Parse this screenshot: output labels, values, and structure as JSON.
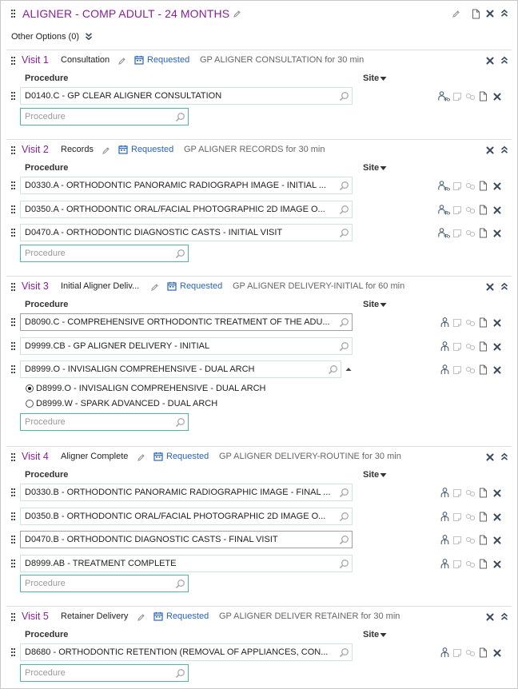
{
  "plan": {
    "title": "ALIGNER - COMP ADULT - 24 MONTHS",
    "other_options": "Other Options (0)"
  },
  "labels": {
    "procedure": "Procedure",
    "site": "Site",
    "procedure_placeholder": "Procedure"
  },
  "visits": [
    {
      "number": "Visit 1",
      "name": "Consultation",
      "status": "Requested",
      "description": "GP ALIGNER CONSULTATION for 30 min",
      "procedures": [
        "D0140.C - GP CLEAR ALIGNER CONSULTATION"
      ]
    },
    {
      "number": "Visit 2",
      "name": "Records",
      "status": "Requested",
      "description": "GP ALIGNER RECORDS for 30 min",
      "procedures": [
        "D0330.A - ORTHODONTIC PANORAMIC RADIOGRAPH IMAGE - INITIAL ...",
        "D0350.A - ORTHODONTIC ORAL/FACIAL PHOTOGRAPHIC 2D IMAGE O...",
        "D0470.A - ORTHODONTIC DIAGNOSTIC CASTS - INITIAL VISIT"
      ]
    },
    {
      "number": "Visit 3",
      "name": "Initial Aligner Deliv...",
      "status": "Requested",
      "description": "GP ALIGNER DELIVERY-INITIAL for 60 min",
      "procedures": [
        "D8090.C - COMPREHENSIVE ORTHODONTIC TREATMENT OF THE ADU...",
        "D9999.CB - GP ALIGNER DELIVERY - INITIAL",
        "D8999.O - INVISALIGN COMPREHENSIVE - DUAL ARCH"
      ],
      "options": [
        {
          "label": "D8999.O - INVISALIGN COMPREHENSIVE - DUAL ARCH",
          "selected": true
        },
        {
          "label": "D8999.W - SPARK ADVANCED - DUAL ARCH",
          "selected": false
        }
      ]
    },
    {
      "number": "Visit 4",
      "name": "Aligner Complete",
      "status": "Requested",
      "description": "GP ALIGNER DELIVERY-ROUTINE for 30 min",
      "procedures": [
        "D0330.B - ORTHODONTIC PANORAMIC RADIOGRAPHIC IMAGE - FINAL ...",
        "D0350.B - ORTHODONTIC ORAL/FACIAL PHOTOGRAPHIC 2D IMAGE O...",
        "D0470.B - ORTHODONTIC DIAGNOSTIC CASTS - FINAL VISIT",
        "D8999.AB - TREATMENT COMPLETE"
      ]
    },
    {
      "number": "Visit 5",
      "name": "Retainer Delivery",
      "status": "Requested",
      "description": "GP ALIGNER DELIVER RETAINER for 30 min",
      "procedures": [
        "D8680 - ORTHODONTIC RETENTION (REMOVAL OF APPLIANCES, CON..."
      ]
    }
  ],
  "colors": {
    "title": "#8a1f9a",
    "requested": "#2a63b7",
    "field_border": "#cfe4df",
    "new_field_border": "#4fb5a0"
  },
  "icons": {
    "grip": "grip-icon",
    "edit": "pencil-icon",
    "document": "document-icon",
    "close": "close-icon",
    "collapse": "double-chevron-up-icon",
    "expand": "double-chevron-down-icon",
    "calendar": "calendar-icon",
    "search": "magnifier-icon",
    "rx": "rx-icon",
    "person": "person-icon",
    "note": "note-icon",
    "link": "link-icon"
  }
}
